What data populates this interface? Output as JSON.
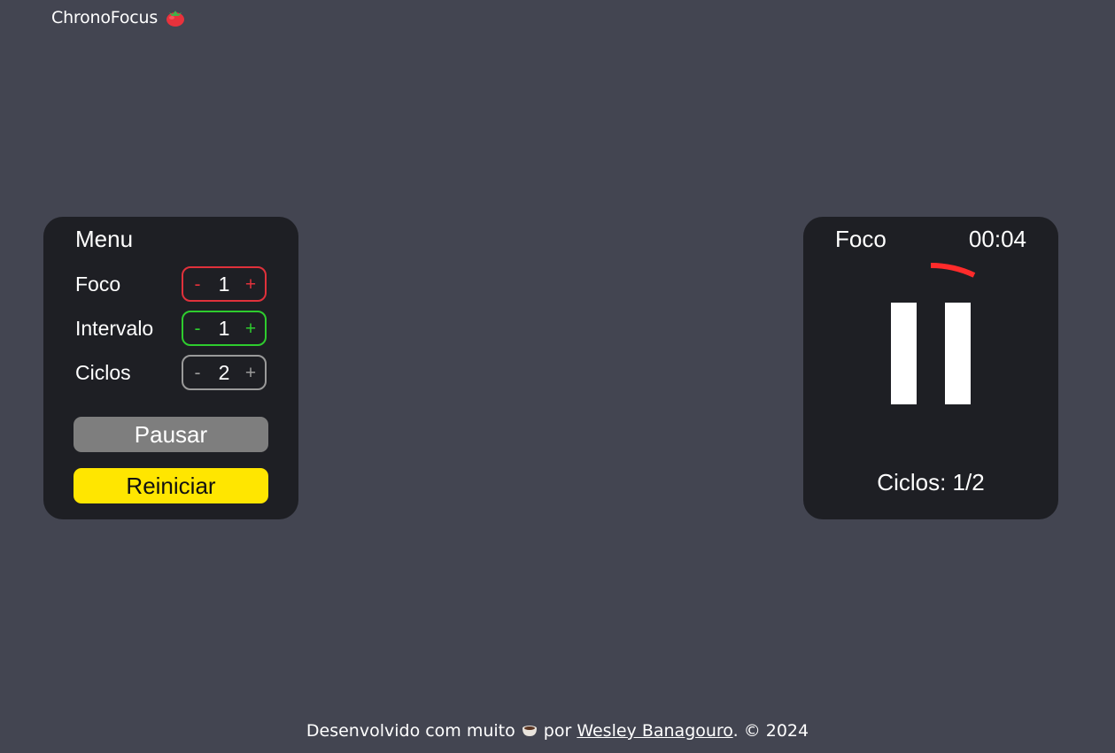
{
  "header": {
    "title": "ChronoFocus",
    "logo_icon": "tomato-icon"
  },
  "menu": {
    "title": "Menu",
    "rows": [
      {
        "label": "Foco",
        "value": "1",
        "minus": "-",
        "plus": "+",
        "color": "#e0313b"
      },
      {
        "label": "Intervalo",
        "value": "1",
        "minus": "-",
        "plus": "+",
        "color": "#2ecc2e"
      },
      {
        "label": "Ciclos",
        "value": "2",
        "minus": "-",
        "plus": "+",
        "color": "#9a9a9a"
      }
    ],
    "pause_label": "Pausar",
    "pause_color": "#7e7e7e",
    "reset_label": "Reiniciar",
    "reset_color": "#ffe600"
  },
  "timer": {
    "mode": "Foco",
    "time": "00:04",
    "progress_fraction": 0.07,
    "progress_color": "#ff2b2b",
    "state_icon": "pause-icon",
    "cycles_label": "Ciclos: 1/2"
  },
  "footer": {
    "text_before": "Desenvolvido com muito",
    "icon": "coffee-icon",
    "text_middle": "por",
    "author_link": "Wesley Banagouro",
    "text_after": ". © 2024"
  }
}
